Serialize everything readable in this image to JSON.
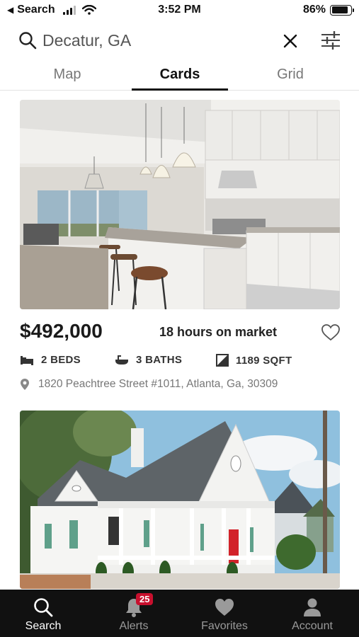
{
  "status_bar": {
    "back_label": "Search",
    "time": "3:52 PM",
    "battery": "86%",
    "battery_level": 0.86
  },
  "search": {
    "query": "Decatur, GA"
  },
  "tabs": [
    {
      "label": "Map"
    },
    {
      "label": "Cards"
    },
    {
      "label": "Grid"
    }
  ],
  "active_tab": "Cards",
  "listings": [
    {
      "price": "$492,000",
      "market_time": "18 hours on market",
      "beds": "2 BEDS",
      "baths": "3 BATHS",
      "sqft": "1189 SQFT",
      "address": "1820 Peachtree Street #1011, Atlanta, Ga, 30309",
      "photo": "kitchen-interior"
    },
    {
      "photo": "white-cottage-exterior"
    }
  ],
  "tab_bar": {
    "items": [
      {
        "label": "Search",
        "icon": "search-icon"
      },
      {
        "label": "Alerts",
        "icon": "bell-icon",
        "badge": "25"
      },
      {
        "label": "Favorites",
        "icon": "heart-icon"
      },
      {
        "label": "Account",
        "icon": "person-icon"
      }
    ],
    "active": "Search"
  },
  "colors": {
    "tab_bar_bg": "#111111",
    "badge": "#c8102e",
    "active": "#ffffff",
    "inactive": "#9a9a9a"
  }
}
